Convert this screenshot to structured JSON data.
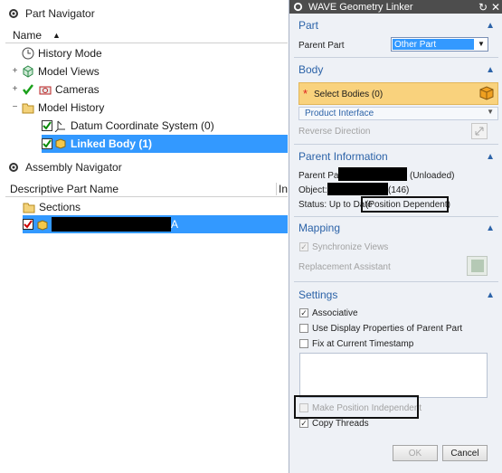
{
  "part_navigator": {
    "title": "Part Navigator",
    "column_name": "Name",
    "items": [
      {
        "label": "History Mode"
      },
      {
        "label": "Model Views"
      },
      {
        "label": "Cameras"
      },
      {
        "label": "Model History"
      },
      {
        "label": "Datum Coordinate System (0)"
      },
      {
        "label": "Linked Body (1)"
      }
    ]
  },
  "assembly_navigator": {
    "title": "Assembly Navigator",
    "column_name": "Descriptive Part Name",
    "column_in": "In",
    "items": [
      {
        "label": "Sections"
      },
      {
        "label": "A"
      }
    ]
  },
  "dialog": {
    "title": "WAVE Geometry Linker",
    "part": {
      "header": "Part",
      "parent_part_label": "Parent Part",
      "parent_part_value": "Other Part"
    },
    "body": {
      "header": "Body",
      "select_bodies": "Select Bodies (0)",
      "product_interface": "Product Interface",
      "reverse_direction": "Reverse Direction"
    },
    "parent_info": {
      "header": "Parent Information",
      "parent_part_prefix": "Parent Part",
      "parent_part_suffix": "(Unloaded)",
      "object_prefix": "Object:",
      "object_suffix": "(146)",
      "status_prefix": "Status: Up to Date",
      "status_suffix": "(Position Dependent)"
    },
    "mapping": {
      "header": "Mapping",
      "synchronize_views": "Synchronize Views",
      "replacement_assistant": "Replacement Assistant"
    },
    "settings": {
      "header": "Settings",
      "associative": "Associative",
      "use_display_props": "Use Display Properties of Parent Part",
      "fix_timestamp": "Fix at Current Timestamp",
      "make_position_independent": "Make Position Independent",
      "copy_threads": "Copy Threads"
    },
    "ok_label": "OK",
    "cancel_label": "Cancel"
  },
  "colors": {
    "selection": "#3399ff",
    "section_header": "#2c63a8",
    "select_row": "#f9d27d",
    "title_bar": "#4d4d4d"
  }
}
